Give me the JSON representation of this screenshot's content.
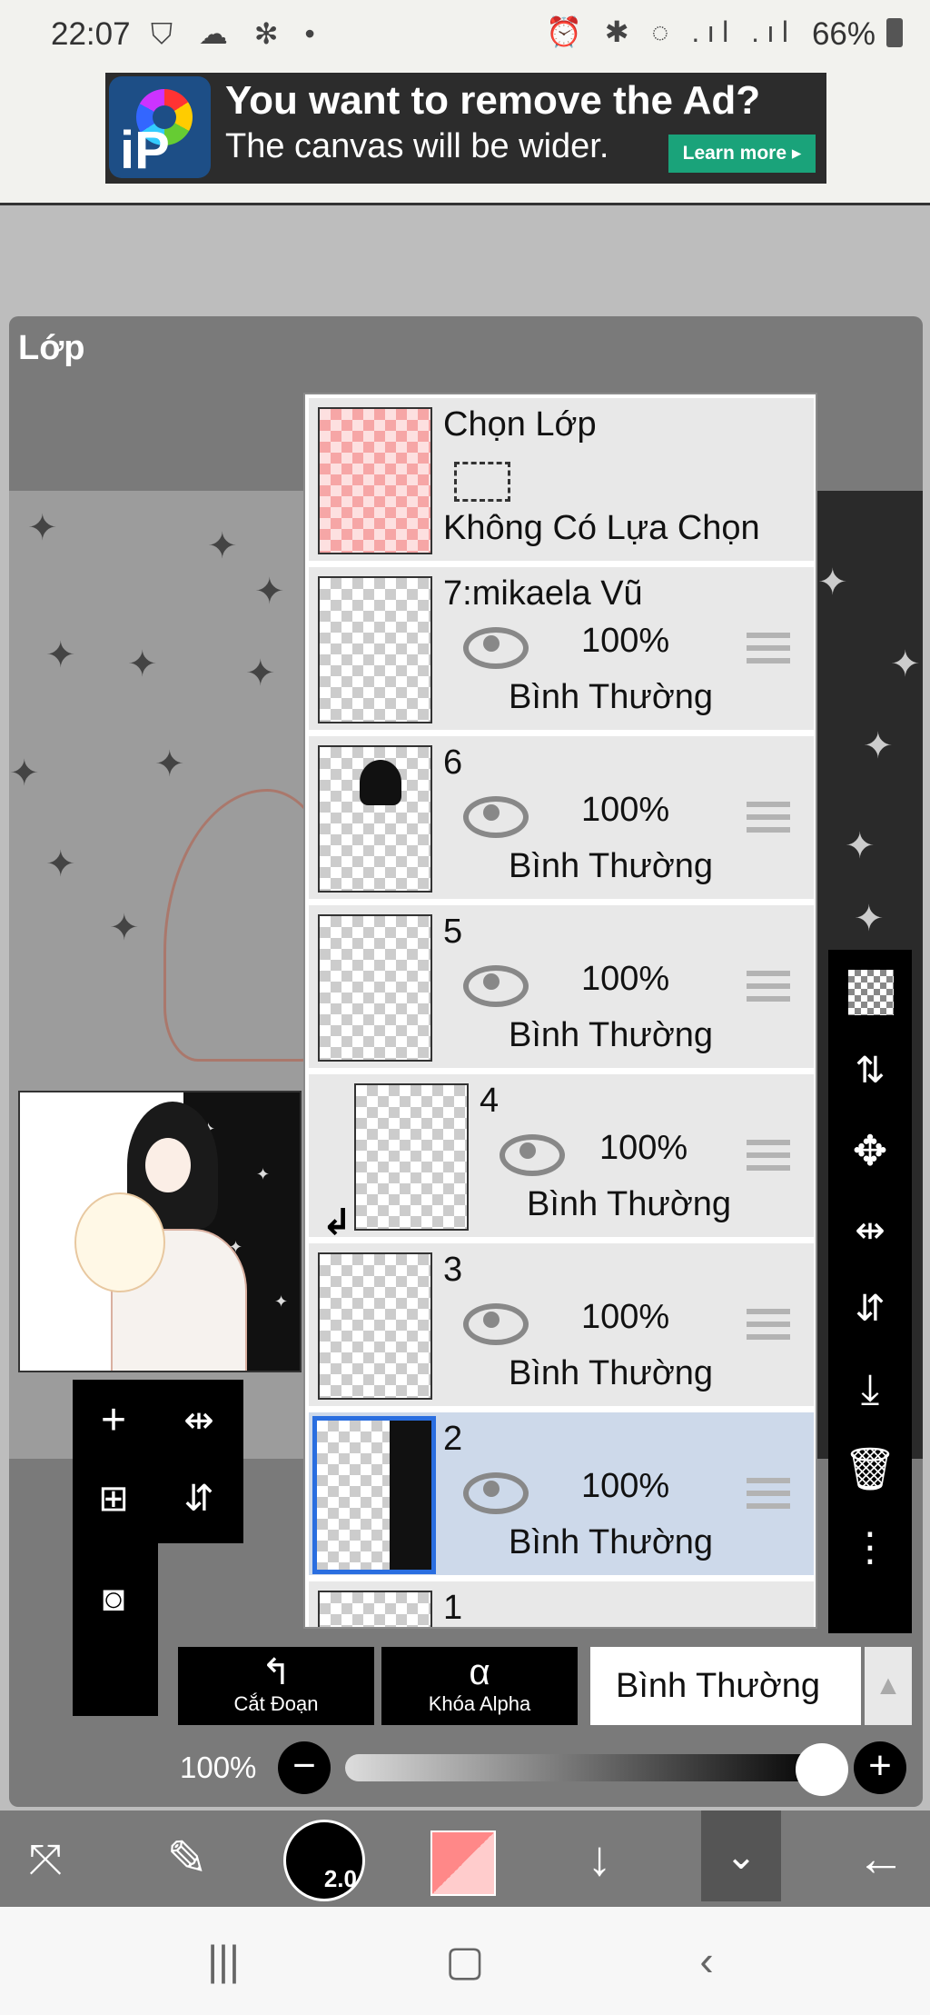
{
  "status_bar": {
    "time": "22:07",
    "left_icons": "⛉ ☁ ✻ •",
    "right_icons": "⏰ ✱ ◌ .ıl .ıl",
    "battery": "66%"
  },
  "ad": {
    "logo_text": "iP",
    "line1": "You want to remove the Ad?",
    "line2": "The canvas will be wider.",
    "button": "Learn more ▸"
  },
  "panel": {
    "title": "Lớp"
  },
  "layers": {
    "selection_layer": {
      "name": "Chọn Lớp",
      "status": "Không Có Lựa Chọn"
    },
    "items": [
      {
        "name": "7:mikaela Vũ",
        "opacity": "100%",
        "blend": "Bình Thường"
      },
      {
        "name": "6",
        "opacity": "100%",
        "blend": "Bình Thường"
      },
      {
        "name": "5",
        "opacity": "100%",
        "blend": "Bình Thường"
      },
      {
        "name": "4",
        "opacity": "100%",
        "blend": "Bình Thường",
        "clipped": true
      },
      {
        "name": "3",
        "opacity": "100%",
        "blend": "Bình Thường"
      },
      {
        "name": "2",
        "opacity": "100%",
        "blend": "Bình Thường",
        "selected": true
      },
      {
        "name": "1"
      }
    ]
  },
  "layer_controls": {
    "clip_label": "Cắt Đoạn",
    "alpha_lock_label": "Khóa Alpha",
    "blend_mode": "Bình Thường",
    "opacity_label": "100%",
    "opacity_value": 1.0
  },
  "brush": {
    "size": "2.0",
    "color": "#f48a8a"
  },
  "colors": {
    "selected_layer": "#cdd9ea",
    "selected_border": "#2a6ee0",
    "ad_button": "#1aa37a"
  }
}
